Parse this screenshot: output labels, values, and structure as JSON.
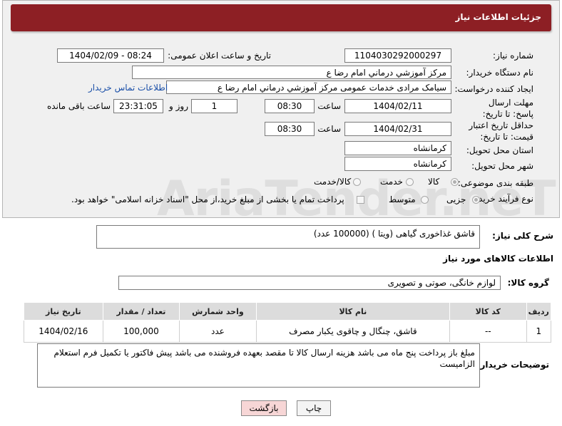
{
  "header": {
    "title": "جزئیات اطلاعات نیاز"
  },
  "fields": {
    "need_number_label": "شماره نیاز:",
    "need_number": "1104030292000297",
    "announce_label": "تاریخ و ساعت اعلان عمومی:",
    "announce_value": "1404/02/09 - 08:24",
    "buyer_org_label": "نام دستگاه خریدار:",
    "buyer_org": "مرکز آموزشي  درماني امام رضا  ع",
    "creator_label": "ایجاد کننده درخواست:",
    "creator": "سیامک مرادی خدمات عمومی مرکز آموزشي  درماني امام رضا  ع",
    "contact_link": "اطلاعات تماس خریدار",
    "deadline_label": "مهلت ارسال پاسخ: تا تاریخ:",
    "deadline_date": "1404/02/11",
    "time_label": "ساعت",
    "deadline_time": "08:30",
    "days_value": "1",
    "days_label": "روز و",
    "remaining_value": "23:31:05",
    "remaining_label": "ساعت باقی مانده",
    "validity_label": "حداقل تاریخ اعتبار قیمت: تا تاریخ:",
    "validity_date": "1404/02/31",
    "validity_time": "08:30",
    "province_label": "استان محل تحویل:",
    "province": "کرمانشاه",
    "city_label": "شهر محل تحویل:",
    "city": "کرمانشاه",
    "category_label": "طبقه بندی موضوعی:",
    "category_options": [
      "کالا",
      "خدمت",
      "کالا/خدمت"
    ],
    "process_label": "نوع فرآیند خرید :",
    "process_options": [
      "جزیی",
      "متوسط"
    ],
    "process_note": "پرداخت تمام یا بخشی از مبلغ خرید،از محل \"اسناد خزانه اسلامی\" خواهد بود."
  },
  "description": {
    "label": "شرح کلی نیاز:",
    "value": "قاشق غذاخوری گیاهی (ویتا )  (100000 عدد)"
  },
  "goods_section": {
    "title": "اطلاعات کالاهای مورد نیاز",
    "group_label": "گروه کالا:",
    "group_value": "لوازم خانگی، صوتی و تصویری"
  },
  "table": {
    "headers": [
      "ردیف",
      "کد کالا",
      "نام کالا",
      "واحد شمارش",
      "تعداد / مقدار",
      "تاریخ نیاز"
    ],
    "rows": [
      [
        "1",
        "--",
        "قاشق، چنگال و چاقوی یکبار مصرف",
        "عدد",
        "100,000",
        "1404/02/16"
      ]
    ]
  },
  "buyer_notes": {
    "label": "توضیحات خریدار:",
    "value": "مبلغ باز پرداخت پنج ماه می باشد هزینه ارسال کالا تا مقصد بعهده فروشنده می باشد پیش فاکتور یا تکمیل فرم استعلام الزامیست"
  },
  "buttons": {
    "print": "چاپ",
    "back": "بازگشت"
  },
  "watermark": "AriaTender.neT",
  "colors": {
    "header_bg": "#8d1f24",
    "link": "#1a4fa8",
    "back_button_bg": "#f7d6d6"
  }
}
